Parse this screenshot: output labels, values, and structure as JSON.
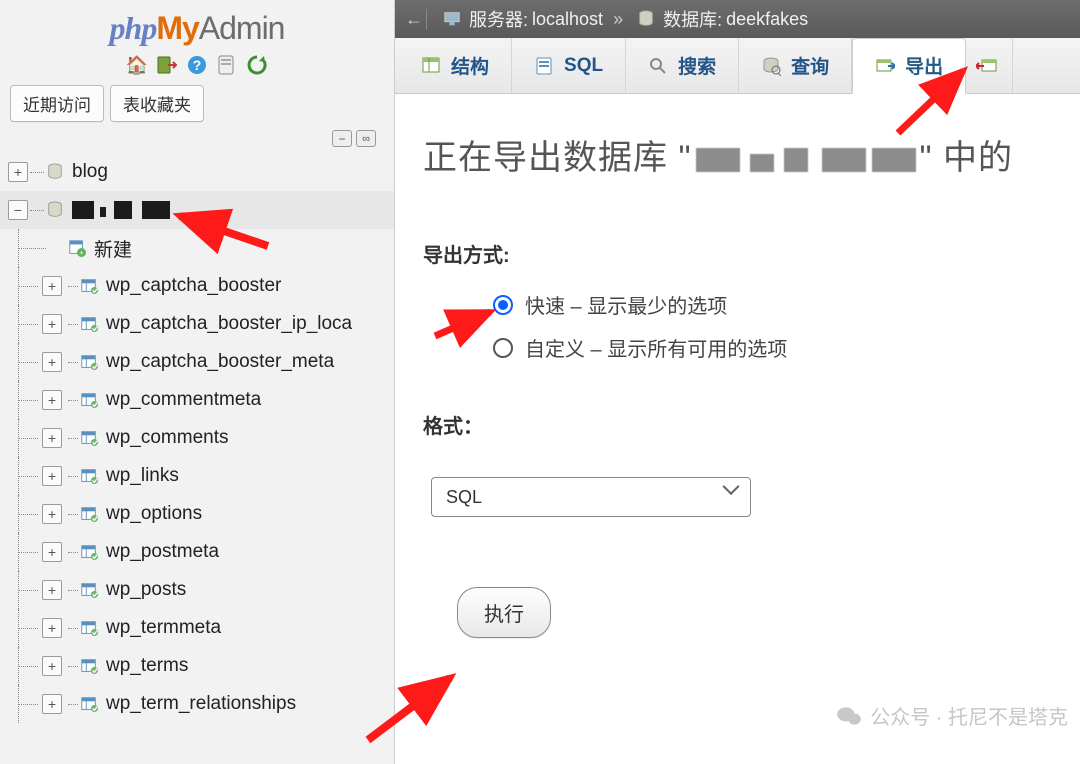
{
  "logo": {
    "php": "php",
    "my": "My",
    "admin": "Admin"
  },
  "sidebar": {
    "tabs": {
      "recent": "近期访问",
      "favorites": "表收藏夹"
    },
    "db_blog": "blog",
    "new_item": "新建",
    "tables": [
      "wp_captcha_booster",
      "wp_captcha_booster_ip_loca",
      "wp_captcha_booster_meta",
      "wp_commentmeta",
      "wp_comments",
      "wp_links",
      "wp_options",
      "wp_postmeta",
      "wp_posts",
      "wp_termmeta",
      "wp_terms",
      "wp_term_relationships"
    ]
  },
  "breadcrumb": {
    "server_label": "服务器: ",
    "server_value": "localhost",
    "db_label": "数据库: ",
    "db_value": "deekfakes",
    "sep": "»"
  },
  "tabs": {
    "structure": "结构",
    "sql": "SQL",
    "search": "搜索",
    "query": "查询",
    "export": "导出"
  },
  "main": {
    "h1_prefix": "正在导出数据库 \"",
    "h1_suffix": "\" 中的",
    "export_method_title": "导出方式:",
    "radio_quick": "快速 – 显示最少的选项",
    "radio_custom": "自定义 – 显示所有可用的选项",
    "format_title": "格式：",
    "format_value": "SQL",
    "exec": "执行"
  },
  "watermark": {
    "label": "公众号 · 托尼不是塔克"
  }
}
